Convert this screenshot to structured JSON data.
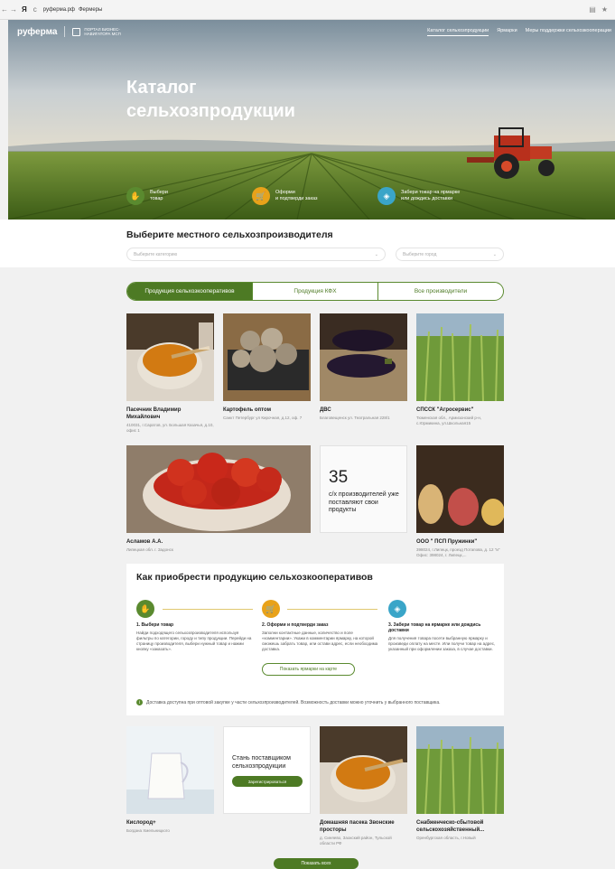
{
  "browser": {
    "url": "руферма.рф",
    "title": "Фермеры",
    "yandex": "Я"
  },
  "header": {
    "logo": "руферма",
    "portal_line1": "ПОРТАЛ БИЗНЕС-",
    "portal_line2": "НАВИГАТОРА МСП",
    "menu": [
      "Каталог сельхозпродукции",
      "Ярмарки",
      "Меры поддержки сельхозкооперации"
    ]
  },
  "hero": {
    "title_line1": "Каталог",
    "title_line2": "сельхозпродукции",
    "steps": [
      {
        "line1": "Выбери",
        "line2": "товар",
        "color": "#5a8a2f",
        "icon": "hand-icon"
      },
      {
        "line1": "Оформи",
        "line2": "и подтверди заказ",
        "color": "#e8a21a",
        "icon": "cart-icon"
      },
      {
        "line1": "Забери товар на ярмарке",
        "line2": "или дождись доставки",
        "color": "#3aa5c8",
        "icon": "tag-icon"
      }
    ]
  },
  "filter": {
    "title": "Выберите местного сельхозпроизводителя",
    "category_placeholder": "Выберите категорию",
    "city_placeholder": "Выберите город"
  },
  "tabs": [
    "Продукция сельхозкооперативов",
    "Продукция КФХ",
    "Все производители"
  ],
  "producers": [
    {
      "name_line1": "Пасечник Владимир",
      "name_line2": "Михайлович",
      "addr": "410031, г.Саратов, ул. Большая Казачья, д.10, офис 1"
    },
    {
      "name_line1": "Картофель оптом",
      "name_line2": "",
      "addr": "Санкт Петербург ул Кирочная, д.12, оф. 7"
    },
    {
      "name_line1": "ДВС",
      "name_line2": "",
      "addr": "Благовещенск ул. Театральная 228/1"
    },
    {
      "name_line1": "СПССК \"Агросервис\"",
      "name_line2": "",
      "addr": "Тюменская обл., Армизонский р-н, с.Юрмикина, ул.Школьная15"
    },
    {
      "name_line1": "Асламов А.А.",
      "name_line2": "",
      "addr": "Липецкая обл. г. Задонск"
    },
    {
      "name_line1": "ООО \" ПСП Пружинки\"",
      "name_line2": "",
      "addr": "398024, г.Липецк, проезд Потапова, д. 12 \"и\" Офис: 398024, г. Липецк,..."
    }
  ],
  "stat": {
    "number": "35",
    "text": "с/х производителей уже поставляют свои продукты"
  },
  "how": {
    "title": "Как приобрести продукцию сельхозкооперативов",
    "steps": [
      {
        "title": "1. Выбери товар",
        "desc": "Найди подходящего сельхозпроизводителя используя фильтры по категории, городу и типу продукции. Перейди на страницу производителя, выбери нужный товар и нажми кнопку «заказать».",
        "color": "#5a8a2f",
        "icon": "hand-icon"
      },
      {
        "title": "2. Оформи и подтверди заказ",
        "desc": "Заполни контактные данные, количество и поле «комментарии». Укажи в комментарии ярмарку, на которой сможешь забрать товар, или остави адрес, если необходима доставка.",
        "color": "#e8a21a",
        "icon": "cart-icon"
      },
      {
        "title": "3. Забери товар на ярмарке или дождись доставки",
        "desc": "Для получения товара посети выбранную ярмарку и произведи оплату на месте. Или получи товар на адрес, указанный при оформлении заказа, в случае доставки.",
        "color": "#3aa5c8",
        "icon": "tag-icon"
      }
    ],
    "map_button": "Показать ярмарки на карте",
    "note": "Доставка доступна при оптовой закупке у части сельхозпроизводителей. Возможность доставки можно уточнить у выбранного поставщика."
  },
  "bottom": [
    {
      "name_line1": "Кислород+",
      "name_line2": "",
      "addr": "Богдана Хмельницкого"
    },
    {
      "name_line1": "Домашняя пасека Звонские",
      "name_line2": "просторы",
      "addr": "д. Синяево, Заокский район, Тульской области РФ"
    },
    {
      "name_line1": "Снабженческо-сбытовой",
      "name_line2": "сельскохозяйственный...",
      "addr": "Оренбургская область, г.Новый"
    }
  ],
  "supplier": {
    "text": "Стань поставщиком сельхозпродукции",
    "button": "Зарегистрироваться"
  },
  "show_all": "Показать всех"
}
